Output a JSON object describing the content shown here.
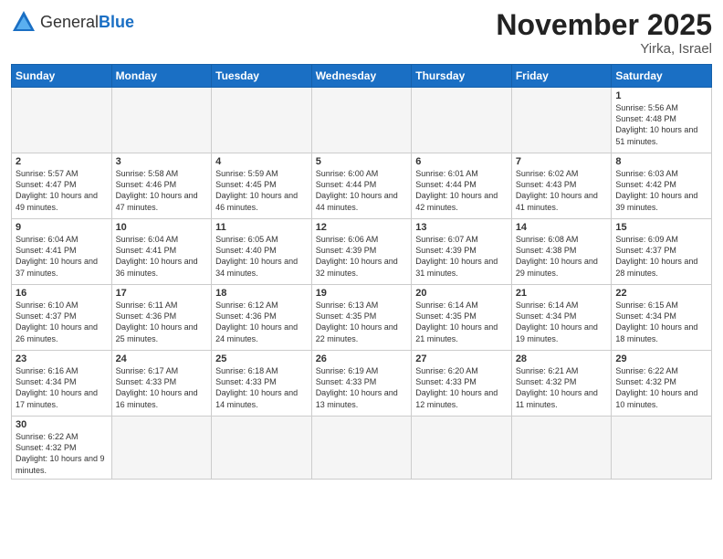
{
  "header": {
    "logo_general": "General",
    "logo_blue": "Blue",
    "month_title": "November 2025",
    "location": "Yirka, Israel"
  },
  "weekdays": [
    "Sunday",
    "Monday",
    "Tuesday",
    "Wednesday",
    "Thursday",
    "Friday",
    "Saturday"
  ],
  "weeks": [
    [
      {
        "day": "",
        "empty": true
      },
      {
        "day": "",
        "empty": true
      },
      {
        "day": "",
        "empty": true
      },
      {
        "day": "",
        "empty": true
      },
      {
        "day": "",
        "empty": true
      },
      {
        "day": "",
        "empty": true
      },
      {
        "day": "1",
        "sunrise": "5:56 AM",
        "sunset": "4:48 PM",
        "daylight": "10 hours and 51 minutes."
      }
    ],
    [
      {
        "day": "2",
        "sunrise": "5:57 AM",
        "sunset": "4:47 PM",
        "daylight": "10 hours and 49 minutes."
      },
      {
        "day": "3",
        "sunrise": "5:58 AM",
        "sunset": "4:46 PM",
        "daylight": "10 hours and 47 minutes."
      },
      {
        "day": "4",
        "sunrise": "5:59 AM",
        "sunset": "4:45 PM",
        "daylight": "10 hours and 46 minutes."
      },
      {
        "day": "5",
        "sunrise": "6:00 AM",
        "sunset": "4:44 PM",
        "daylight": "10 hours and 44 minutes."
      },
      {
        "day": "6",
        "sunrise": "6:01 AM",
        "sunset": "4:44 PM",
        "daylight": "10 hours and 42 minutes."
      },
      {
        "day": "7",
        "sunrise": "6:02 AM",
        "sunset": "4:43 PM",
        "daylight": "10 hours and 41 minutes."
      },
      {
        "day": "8",
        "sunrise": "6:03 AM",
        "sunset": "4:42 PM",
        "daylight": "10 hours and 39 minutes."
      }
    ],
    [
      {
        "day": "9",
        "sunrise": "6:04 AM",
        "sunset": "4:41 PM",
        "daylight": "10 hours and 37 minutes."
      },
      {
        "day": "10",
        "sunrise": "6:04 AM",
        "sunset": "4:41 PM",
        "daylight": "10 hours and 36 minutes."
      },
      {
        "day": "11",
        "sunrise": "6:05 AM",
        "sunset": "4:40 PM",
        "daylight": "10 hours and 34 minutes."
      },
      {
        "day": "12",
        "sunrise": "6:06 AM",
        "sunset": "4:39 PM",
        "daylight": "10 hours and 32 minutes."
      },
      {
        "day": "13",
        "sunrise": "6:07 AM",
        "sunset": "4:39 PM",
        "daylight": "10 hours and 31 minutes."
      },
      {
        "day": "14",
        "sunrise": "6:08 AM",
        "sunset": "4:38 PM",
        "daylight": "10 hours and 29 minutes."
      },
      {
        "day": "15",
        "sunrise": "6:09 AM",
        "sunset": "4:37 PM",
        "daylight": "10 hours and 28 minutes."
      }
    ],
    [
      {
        "day": "16",
        "sunrise": "6:10 AM",
        "sunset": "4:37 PM",
        "daylight": "10 hours and 26 minutes."
      },
      {
        "day": "17",
        "sunrise": "6:11 AM",
        "sunset": "4:36 PM",
        "daylight": "10 hours and 25 minutes."
      },
      {
        "day": "18",
        "sunrise": "6:12 AM",
        "sunset": "4:36 PM",
        "daylight": "10 hours and 24 minutes."
      },
      {
        "day": "19",
        "sunrise": "6:13 AM",
        "sunset": "4:35 PM",
        "daylight": "10 hours and 22 minutes."
      },
      {
        "day": "20",
        "sunrise": "6:14 AM",
        "sunset": "4:35 PM",
        "daylight": "10 hours and 21 minutes."
      },
      {
        "day": "21",
        "sunrise": "6:14 AM",
        "sunset": "4:34 PM",
        "daylight": "10 hours and 19 minutes."
      },
      {
        "day": "22",
        "sunrise": "6:15 AM",
        "sunset": "4:34 PM",
        "daylight": "10 hours and 18 minutes."
      }
    ],
    [
      {
        "day": "23",
        "sunrise": "6:16 AM",
        "sunset": "4:34 PM",
        "daylight": "10 hours and 17 minutes."
      },
      {
        "day": "24",
        "sunrise": "6:17 AM",
        "sunset": "4:33 PM",
        "daylight": "10 hours and 16 minutes."
      },
      {
        "day": "25",
        "sunrise": "6:18 AM",
        "sunset": "4:33 PM",
        "daylight": "10 hours and 14 minutes."
      },
      {
        "day": "26",
        "sunrise": "6:19 AM",
        "sunset": "4:33 PM",
        "daylight": "10 hours and 13 minutes."
      },
      {
        "day": "27",
        "sunrise": "6:20 AM",
        "sunset": "4:33 PM",
        "daylight": "10 hours and 12 minutes."
      },
      {
        "day": "28",
        "sunrise": "6:21 AM",
        "sunset": "4:32 PM",
        "daylight": "10 hours and 11 minutes."
      },
      {
        "day": "29",
        "sunrise": "6:22 AM",
        "sunset": "4:32 PM",
        "daylight": "10 hours and 10 minutes."
      }
    ],
    [
      {
        "day": "30",
        "sunrise": "6:22 AM",
        "sunset": "4:32 PM",
        "daylight": "10 hours and 9 minutes."
      },
      {
        "day": "",
        "empty": true
      },
      {
        "day": "",
        "empty": true
      },
      {
        "day": "",
        "empty": true
      },
      {
        "day": "",
        "empty": true
      },
      {
        "day": "",
        "empty": true
      },
      {
        "day": "",
        "empty": true
      }
    ]
  ]
}
